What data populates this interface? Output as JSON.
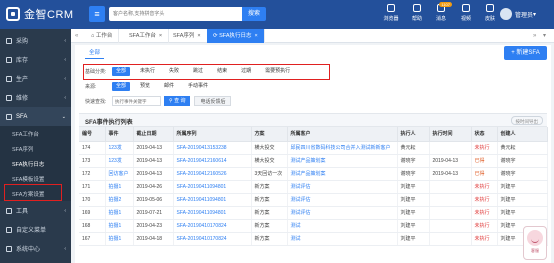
{
  "app": {
    "brand": "金智CRM",
    "search_placeholder": "客户名称,支持拼音字头",
    "search_label": "搜索"
  },
  "top_tools": [
    {
      "label": "浏览器",
      "icon": "browser-icon"
    },
    {
      "label": "帮助",
      "icon": "help-icon"
    },
    {
      "label": "消息",
      "icon": "message-icon",
      "badge": "1107"
    },
    {
      "label": "视频",
      "icon": "video-icon"
    },
    {
      "label": "皮肤",
      "icon": "skin-icon"
    }
  ],
  "user": {
    "name": "管理员"
  },
  "sidebar": {
    "items": [
      {
        "label": "采购",
        "icon": "cart-icon"
      },
      {
        "label": "库存",
        "icon": "warehouse-icon"
      },
      {
        "label": "生产",
        "icon": "factory-icon"
      },
      {
        "label": "维修",
        "icon": "wrench-icon"
      },
      {
        "label": "SFA",
        "icon": "sfa-icon"
      }
    ],
    "sub": [
      "SFA工作台",
      "SFA序列",
      "SFA执行日志",
      "SFA模板设置",
      "SFA方案设置"
    ],
    "bottom": [
      {
        "label": "工具",
        "icon": "tool-icon"
      },
      {
        "label": "自定义菜单",
        "icon": "menu-icon"
      },
      {
        "label": "系统中心",
        "icon": "system-icon"
      }
    ]
  },
  "tabs": [
    "工作台",
    "SFA工作台",
    "SFA序列",
    "SFA执行日志"
  ],
  "panel": {
    "subtab": "全部",
    "new_button": "+ 新建SFA",
    "filter_basic_label": "基础分类:",
    "filter_basic": [
      "全部",
      "未执行",
      "失败",
      "跳过",
      "结束",
      "过期",
      "需要预执行"
    ],
    "filter_source_label": "来源:",
    "filter_source": [
      "全部",
      "预览",
      "邮件",
      "手动事件"
    ],
    "quick_label": "快速查找:",
    "quick_placeholder": "执行事件关键字",
    "query_button": "查 询",
    "reset_button": "电话反馈后"
  },
  "list": {
    "title": "SFA事件执行列表",
    "export": "按时间导出",
    "columns": [
      "编号",
      "事件",
      "截止日期",
      "所属序列",
      "方案",
      "所属客户",
      "执行人",
      "执行时间",
      "状态",
      "创建人"
    ],
    "rows": [
      [
        "174",
        "123发",
        "2019-04-13",
        "SFA-20190413153238",
        "横大投交",
        "邱民四川省数码科技公司合并入测试新新客户",
        "黄元耘",
        "",
        "未执行",
        "黄元耘"
      ],
      [
        "173",
        "123发",
        "2019-04-13",
        "SFA-20190412160614",
        "横大投交",
        "测试产品策划案",
        "谢晓宇",
        "2019-04-13",
        "已得",
        "谢晓宇"
      ],
      [
        "172",
        "回访客户",
        "2019-04-13",
        "SFA-20190412160526",
        "3天回访一次",
        "测试产品策划案",
        "谢晓宇",
        "2019-04-13",
        "已得",
        "谢晓宇"
      ],
      [
        "171",
        "拍摄1",
        "2019-04-26",
        "SFA-20190411094801",
        "新方案",
        "测试评估",
        "刘建平",
        "",
        "未执行",
        "刘建平"
      ],
      [
        "170",
        "拍摄2",
        "2019-05-06",
        "SFA-20190411094801",
        "新方案",
        "测试评估",
        "刘建平",
        "",
        "未执行",
        "刘建平"
      ],
      [
        "169",
        "拍摄1",
        "2019-07-21",
        "SFA-20190411094801",
        "新方案",
        "测试评估",
        "刘建平",
        "",
        "未执行",
        "刘建平"
      ],
      [
        "168",
        "拍摄1",
        "2019-04-23",
        "SFA-20190410170824",
        "新方案",
        "测试",
        "刘建平",
        "",
        "未执行",
        "刘建平"
      ],
      [
        "167",
        "拍摄1",
        "2019-04-18",
        "SFA-20190410170824",
        "新方案",
        "测试",
        "刘建平",
        "",
        "未执行",
        "刘建平"
      ]
    ]
  },
  "widget": {
    "label": "客服"
  }
}
